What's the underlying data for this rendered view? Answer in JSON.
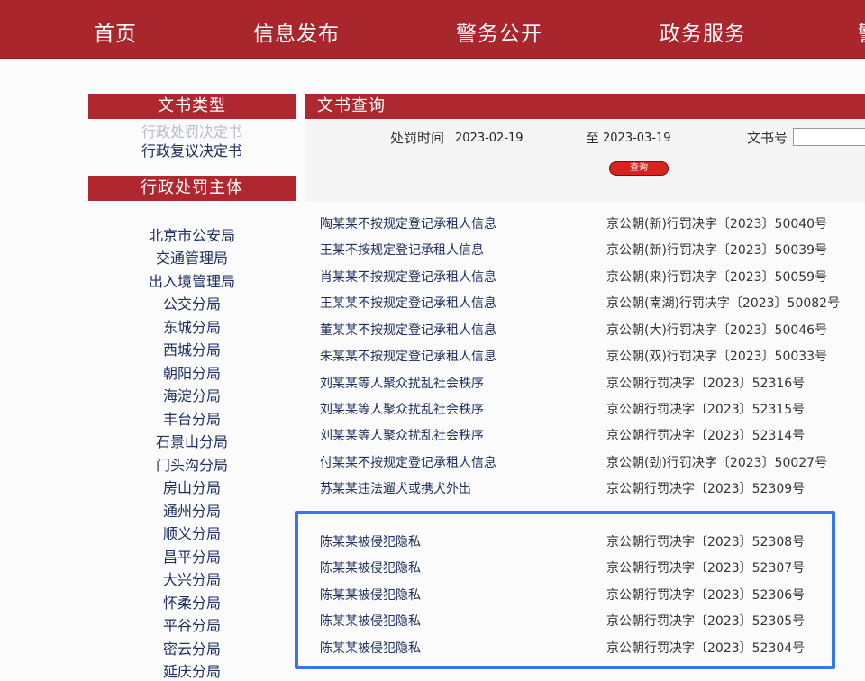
{
  "nav": {
    "items": [
      "首页",
      "信息发布",
      "警务公开",
      "政务服务",
      "警"
    ]
  },
  "sidebar": {
    "doc_type_title": "文书类型",
    "doc_types": [
      "行政处罚决定书",
      "行政复议决定书"
    ],
    "authority_title": "行政处罚主体",
    "agencies": [
      "北京市公安局",
      "交通管理局",
      "出入境管理局",
      "公交分局",
      "东城分局",
      "西城分局",
      "朝阳分局",
      "海淀分局",
      "丰台分局",
      "石景山分局",
      "门头沟分局",
      "房山分局",
      "通州分局",
      "顺义分局",
      "昌平分局",
      "大兴分局",
      "怀柔分局",
      "平谷分局",
      "密云分局",
      "延庆分局"
    ]
  },
  "query": {
    "title": "文书查询",
    "time_label": "处罚时间",
    "date_from": "2023-02-19",
    "to_label": "至",
    "date_to": "2023-03-19",
    "docno_label": "文书号",
    "docno_value": "",
    "search_label": "查询"
  },
  "results": [
    {
      "name": "陶某某不按规定登记承租人信息",
      "docno": "京公朝(新)行罚决字〔2023〕50040号"
    },
    {
      "name": "王某不按规定登记承租人信息",
      "docno": "京公朝(新)行罚决字〔2023〕50039号"
    },
    {
      "name": "肖某某不按规定登记承租人信息",
      "docno": "京公朝(来)行罚决字〔2023〕50059号"
    },
    {
      "name": "王某某不按规定登记承租人信息",
      "docno": "京公朝(南湖)行罚决字〔2023〕50082号"
    },
    {
      "name": "董某某不按规定登记承租人信息",
      "docno": "京公朝(大)行罚决字〔2023〕50046号"
    },
    {
      "name": "朱某某不按规定登记承租人信息",
      "docno": "京公朝(双)行罚决字〔2023〕50033号"
    },
    {
      "name": "刘某某等人聚众扰乱社会秩序",
      "docno": "京公朝行罚决字〔2023〕52316号"
    },
    {
      "name": "刘某某等人聚众扰乱社会秩序",
      "docno": "京公朝行罚决字〔2023〕52315号"
    },
    {
      "name": "刘某某等人聚众扰乱社会秩序",
      "docno": "京公朝行罚决字〔2023〕52314号"
    },
    {
      "name": "付某某不按规定登记承租人信息",
      "docno": "京公朝(劲)行罚决字〔2023〕50027号"
    },
    {
      "name": "苏某某违法遛犬或携犬外出",
      "docno": "京公朝行罚决字〔2023〕52309号"
    },
    {
      "name": "陈某某被侵犯隐私",
      "docno": "京公朝行罚决字〔2023〕52308号"
    },
    {
      "name": "陈某某被侵犯隐私",
      "docno": "京公朝行罚决字〔2023〕52307号"
    },
    {
      "name": "陈某某被侵犯隐私",
      "docno": "京公朝行罚决字〔2023〕52306号"
    },
    {
      "name": "陈某某被侵犯隐私",
      "docno": "京公朝行罚决字〔2023〕52305号"
    },
    {
      "name": "陈某某被侵犯隐私",
      "docno": "京公朝行罚决字〔2023〕52304号"
    }
  ],
  "colors": {
    "brand_red": "#a8262c",
    "highlight_blue": "#3477e8",
    "link_blue": "#1e3060"
  }
}
